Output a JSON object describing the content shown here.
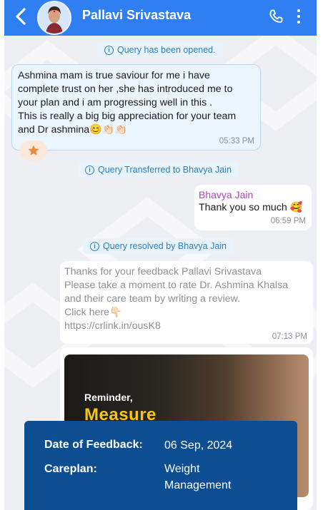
{
  "header": {
    "title": "Pallavi Srivastava",
    "colors": {
      "bar": "#2f7ff2"
    },
    "icons": [
      "back-arrow-icon",
      "avatar",
      "phone-icon",
      "more-vertical-icon"
    ]
  },
  "chat": {
    "sys_opened": "Query has been opened.",
    "msg1": {
      "lines": [
        "Ashmina mam is true saviour for me i have",
        "complete trust on her ,she has introduced me to",
        "your plan and i am progressing well in this .",
        "This is really a big big appreciation for your team",
        "and Dr ashmina😊👏🏻👏🏻"
      ],
      "time": "05:33 PM",
      "reaction": "star-icon"
    },
    "sys_transferred": "Query Transferred to Bhavya Jain",
    "msg2": {
      "sender": "Bhavya Jain",
      "text": "Thank you so much 🥰",
      "time": "06:59 PM"
    },
    "sys_resolved": "Query resolved by Bhavya Jain",
    "msg3": {
      "lines": [
        "Thanks for your feedback Pallavi Srivastava",
        "Please take a moment to rate Dr. Ashmina Khalsa",
        "and their care team by writing a review.",
        "Click here👇🏻",
        "https://crlink.in/ousK8"
      ],
      "time": "07:13 PM"
    },
    "promo": {
      "reminder": "Reminder,",
      "headline": "Measure"
    }
  },
  "overlay": {
    "date_label": "Date of Feedback:",
    "date_value": "06 Sep, 2024",
    "careplan_label": "Careplan:",
    "careplan_line1": "Weight",
    "careplan_line2": "Management"
  }
}
